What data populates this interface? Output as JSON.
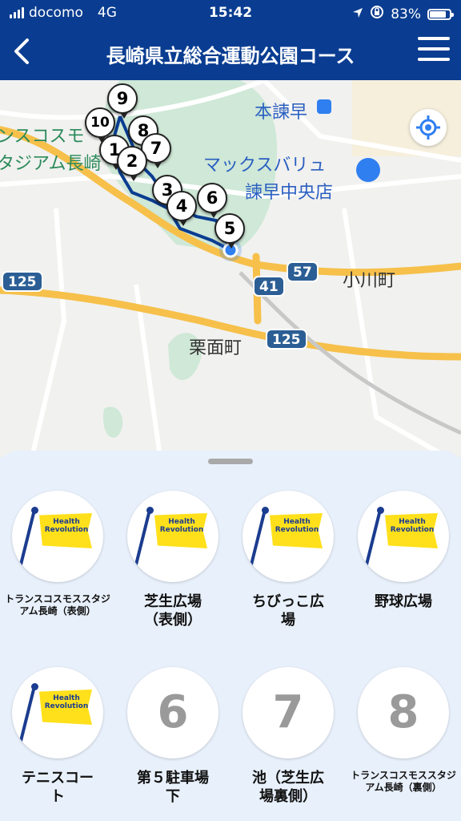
{
  "status_bar": {
    "carrier": "docomo",
    "network": "4G",
    "time": "15:42",
    "battery": "83%",
    "battery_level": 0.83
  },
  "header": {
    "title": "長崎県立総合運動公園コース",
    "back_icon": "chevron-left-icon",
    "menu_icon": "hamburger-menu-icon"
  },
  "map": {
    "labels": {
      "honisahaya": "本諫早",
      "maxvalu_1": "マックスバリュ",
      "maxvalu_2": "諫早中央店",
      "ogawa": "小川町",
      "kurimen": "栗面町",
      "stadium_1": "ンスコスモ",
      "stadium_2": "タジアム長崎"
    },
    "route_shields": [
      "125",
      "57",
      "41",
      "125"
    ],
    "pins": [
      "9",
      "10",
      "8",
      "1",
      "7",
      "2",
      "3",
      "6",
      "4",
      "5"
    ],
    "colors": {
      "route": "#0a3d91",
      "park": "#cfe8d7",
      "highway": "#f6c04a"
    }
  },
  "spots": [
    {
      "label": "トランスコスモススタジアム長崎（表側）",
      "type": "flag",
      "flag_text": "Health Revolution"
    },
    {
      "label": "芝生広場（表側）",
      "type": "flag",
      "flag_text": "Health Revolution"
    },
    {
      "label": "ちびっこ広場",
      "type": "flag",
      "flag_text": "Health Revolution"
    },
    {
      "label": "野球広場",
      "type": "flag",
      "flag_text": "Health Revolution"
    },
    {
      "label": "テニスコート",
      "type": "flag",
      "flag_text": "Health Revolution"
    },
    {
      "label": "第５駐車場下",
      "type": "number",
      "number": "6"
    },
    {
      "label": "池（芝生広場裏側）",
      "type": "number",
      "number": "7"
    },
    {
      "label": "トランスコスモススタジアム長崎（裏側）",
      "type": "number",
      "number": "8"
    }
  ]
}
